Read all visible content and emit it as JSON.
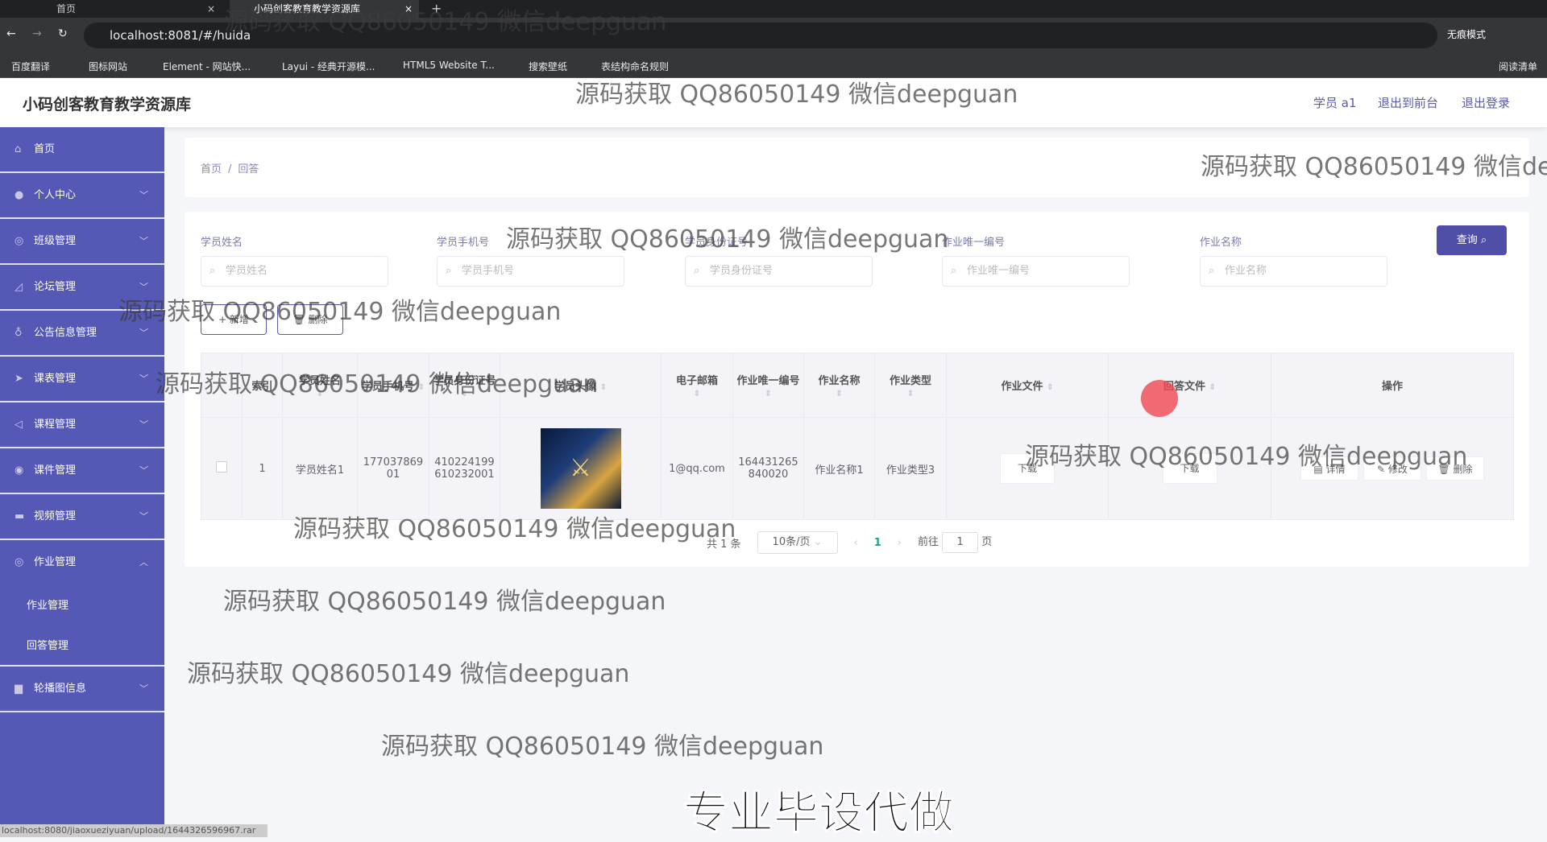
{
  "browser": {
    "tabs": [
      {
        "title": "首页"
      },
      {
        "title": "小码创客教育教学资源库"
      }
    ],
    "url": "localhost:8081/#/huida",
    "incognito": "无痕模式",
    "bookmarks": [
      "百度翻译",
      "图标网站",
      "Element - 网站快...",
      "Layui - 经典开源模...",
      "HTML5 Website T...",
      "搜索壁纸",
      "表结构命名规则"
    ],
    "reading_list": "阅读清单",
    "status_url": "localhost:8080/jiaoxueziyuan/upload/1644326596967.rar"
  },
  "header": {
    "title": "小码创客教育教学资源库",
    "user": "学员 a1",
    "to_front": "退出到前台",
    "logout": "退出登录"
  },
  "sidebar": {
    "items": [
      {
        "label": "首页",
        "icon": "home-icon"
      },
      {
        "label": "个人中心",
        "icon": "user-icon"
      },
      {
        "label": "班级管理",
        "icon": "class-icon"
      },
      {
        "label": "论坛管理",
        "icon": "forum-icon"
      },
      {
        "label": "公告信息管理",
        "icon": "mic-icon"
      },
      {
        "label": "课表管理",
        "icon": "send-icon"
      },
      {
        "label": "课程管理",
        "icon": "navigate-icon"
      },
      {
        "label": "课件管理",
        "icon": "disc-icon"
      },
      {
        "label": "视频管理",
        "icon": "video-icon"
      },
      {
        "label": "作业管理",
        "icon": "homework-icon"
      }
    ],
    "sub": [
      "作业管理",
      "回答管理"
    ],
    "last": {
      "label": "轮播图信息",
      "icon": "monitor-icon"
    }
  },
  "breadcrumb": [
    "首页",
    "回答"
  ],
  "search": {
    "fields": [
      {
        "label": "学员姓名",
        "placeholder": "学员姓名"
      },
      {
        "label": "学员手机号",
        "placeholder": "学员手机号"
      },
      {
        "label": "学员身份证号",
        "placeholder": "学员身份证号"
      },
      {
        "label": "作业唯一编号",
        "placeholder": "作业唯一编号"
      },
      {
        "label": "作业名称",
        "placeholder": "作业名称"
      }
    ],
    "query": "查询 ⌕",
    "add": "+ 新增",
    "delete": "🗑 删除"
  },
  "table": {
    "headers": [
      "索引",
      "学员姓名",
      "学员手机号",
      "学员身份证号",
      "学员头像",
      "电子邮箱",
      "作业唯一编号",
      "作业名称",
      "作业类型",
      "作业文件",
      "回答文件",
      "操作"
    ],
    "rows": [
      {
        "index": "1",
        "name": "学员姓名1",
        "phone": "17703786901",
        "idcard": "410224199610232001",
        "email": "1@qq.com",
        "hw_no": "164431265840020",
        "hw_name": "作业名称1",
        "hw_type": "作业类型3",
        "hw_file": "下载",
        "answer_file": "下载",
        "ops": [
          "详情",
          "修改",
          "删除"
        ]
      }
    ]
  },
  "pagination": {
    "total": "共 1 条",
    "page_size": "10条/页",
    "current": "1",
    "goto": "前往",
    "goto_value": "1",
    "page_suffix": "页"
  },
  "watermark": "源码获取 QQ86050149 微信deepguan",
  "promo": "专业毕设代做"
}
